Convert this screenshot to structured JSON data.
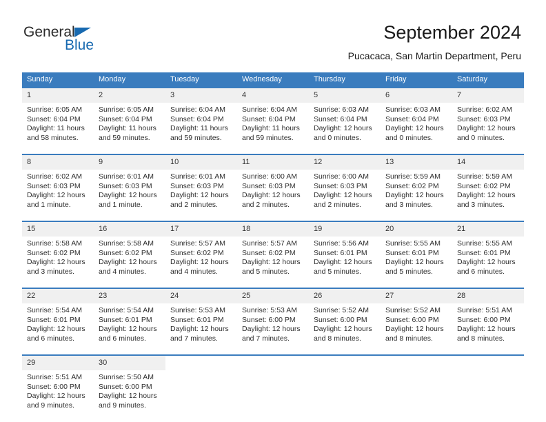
{
  "brand": {
    "name_part1": "General",
    "name_part2": "Blue"
  },
  "header": {
    "title": "September 2024",
    "subtitle": "Pucacaca, San Martin Department, Peru"
  },
  "colors": {
    "header_blue": "#3a7cbe",
    "brand_blue": "#1769b0",
    "daynum_background": "#f0f0f0",
    "text": "#1a1a1a"
  },
  "weekdays": [
    "Sunday",
    "Monday",
    "Tuesday",
    "Wednesday",
    "Thursday",
    "Friday",
    "Saturday"
  ],
  "labels": {
    "sunrise_prefix": "Sunrise:",
    "sunset_prefix": "Sunset:",
    "daylight_prefix": "Daylight:"
  },
  "weeks": [
    [
      {
        "day": "1",
        "sunrise": "Sunrise: 6:05 AM",
        "sunset": "Sunset: 6:04 PM",
        "daylight": "Daylight: 11 hours and 58 minutes."
      },
      {
        "day": "2",
        "sunrise": "Sunrise: 6:05 AM",
        "sunset": "Sunset: 6:04 PM",
        "daylight": "Daylight: 11 hours and 59 minutes."
      },
      {
        "day": "3",
        "sunrise": "Sunrise: 6:04 AM",
        "sunset": "Sunset: 6:04 PM",
        "daylight": "Daylight: 11 hours and 59 minutes."
      },
      {
        "day": "4",
        "sunrise": "Sunrise: 6:04 AM",
        "sunset": "Sunset: 6:04 PM",
        "daylight": "Daylight: 11 hours and 59 minutes."
      },
      {
        "day": "5",
        "sunrise": "Sunrise: 6:03 AM",
        "sunset": "Sunset: 6:04 PM",
        "daylight": "Daylight: 12 hours and 0 minutes."
      },
      {
        "day": "6",
        "sunrise": "Sunrise: 6:03 AM",
        "sunset": "Sunset: 6:04 PM",
        "daylight": "Daylight: 12 hours and 0 minutes."
      },
      {
        "day": "7",
        "sunrise": "Sunrise: 6:02 AM",
        "sunset": "Sunset: 6:03 PM",
        "daylight": "Daylight: 12 hours and 0 minutes."
      }
    ],
    [
      {
        "day": "8",
        "sunrise": "Sunrise: 6:02 AM",
        "sunset": "Sunset: 6:03 PM",
        "daylight": "Daylight: 12 hours and 1 minute."
      },
      {
        "day": "9",
        "sunrise": "Sunrise: 6:01 AM",
        "sunset": "Sunset: 6:03 PM",
        "daylight": "Daylight: 12 hours and 1 minute."
      },
      {
        "day": "10",
        "sunrise": "Sunrise: 6:01 AM",
        "sunset": "Sunset: 6:03 PM",
        "daylight": "Daylight: 12 hours and 2 minutes."
      },
      {
        "day": "11",
        "sunrise": "Sunrise: 6:00 AM",
        "sunset": "Sunset: 6:03 PM",
        "daylight": "Daylight: 12 hours and 2 minutes."
      },
      {
        "day": "12",
        "sunrise": "Sunrise: 6:00 AM",
        "sunset": "Sunset: 6:03 PM",
        "daylight": "Daylight: 12 hours and 2 minutes."
      },
      {
        "day": "13",
        "sunrise": "Sunrise: 5:59 AM",
        "sunset": "Sunset: 6:02 PM",
        "daylight": "Daylight: 12 hours and 3 minutes."
      },
      {
        "day": "14",
        "sunrise": "Sunrise: 5:59 AM",
        "sunset": "Sunset: 6:02 PM",
        "daylight": "Daylight: 12 hours and 3 minutes."
      }
    ],
    [
      {
        "day": "15",
        "sunrise": "Sunrise: 5:58 AM",
        "sunset": "Sunset: 6:02 PM",
        "daylight": "Daylight: 12 hours and 3 minutes."
      },
      {
        "day": "16",
        "sunrise": "Sunrise: 5:58 AM",
        "sunset": "Sunset: 6:02 PM",
        "daylight": "Daylight: 12 hours and 4 minutes."
      },
      {
        "day": "17",
        "sunrise": "Sunrise: 5:57 AM",
        "sunset": "Sunset: 6:02 PM",
        "daylight": "Daylight: 12 hours and 4 minutes."
      },
      {
        "day": "18",
        "sunrise": "Sunrise: 5:57 AM",
        "sunset": "Sunset: 6:02 PM",
        "daylight": "Daylight: 12 hours and 5 minutes."
      },
      {
        "day": "19",
        "sunrise": "Sunrise: 5:56 AM",
        "sunset": "Sunset: 6:01 PM",
        "daylight": "Daylight: 12 hours and 5 minutes."
      },
      {
        "day": "20",
        "sunrise": "Sunrise: 5:55 AM",
        "sunset": "Sunset: 6:01 PM",
        "daylight": "Daylight: 12 hours and 5 minutes."
      },
      {
        "day": "21",
        "sunrise": "Sunrise: 5:55 AM",
        "sunset": "Sunset: 6:01 PM",
        "daylight": "Daylight: 12 hours and 6 minutes."
      }
    ],
    [
      {
        "day": "22",
        "sunrise": "Sunrise: 5:54 AM",
        "sunset": "Sunset: 6:01 PM",
        "daylight": "Daylight: 12 hours and 6 minutes."
      },
      {
        "day": "23",
        "sunrise": "Sunrise: 5:54 AM",
        "sunset": "Sunset: 6:01 PM",
        "daylight": "Daylight: 12 hours and 6 minutes."
      },
      {
        "day": "24",
        "sunrise": "Sunrise: 5:53 AM",
        "sunset": "Sunset: 6:01 PM",
        "daylight": "Daylight: 12 hours and 7 minutes."
      },
      {
        "day": "25",
        "sunrise": "Sunrise: 5:53 AM",
        "sunset": "Sunset: 6:00 PM",
        "daylight": "Daylight: 12 hours and 7 minutes."
      },
      {
        "day": "26",
        "sunrise": "Sunrise: 5:52 AM",
        "sunset": "Sunset: 6:00 PM",
        "daylight": "Daylight: 12 hours and 8 minutes."
      },
      {
        "day": "27",
        "sunrise": "Sunrise: 5:52 AM",
        "sunset": "Sunset: 6:00 PM",
        "daylight": "Daylight: 12 hours and 8 minutes."
      },
      {
        "day": "28",
        "sunrise": "Sunrise: 5:51 AM",
        "sunset": "Sunset: 6:00 PM",
        "daylight": "Daylight: 12 hours and 8 minutes."
      }
    ],
    [
      {
        "day": "29",
        "sunrise": "Sunrise: 5:51 AM",
        "sunset": "Sunset: 6:00 PM",
        "daylight": "Daylight: 12 hours and 9 minutes."
      },
      {
        "day": "30",
        "sunrise": "Sunrise: 5:50 AM",
        "sunset": "Sunset: 6:00 PM",
        "daylight": "Daylight: 12 hours and 9 minutes."
      },
      {
        "day": "",
        "sunrise": "",
        "sunset": "",
        "daylight": ""
      },
      {
        "day": "",
        "sunrise": "",
        "sunset": "",
        "daylight": ""
      },
      {
        "day": "",
        "sunrise": "",
        "sunset": "",
        "daylight": ""
      },
      {
        "day": "",
        "sunrise": "",
        "sunset": "",
        "daylight": ""
      },
      {
        "day": "",
        "sunrise": "",
        "sunset": "",
        "daylight": ""
      }
    ]
  ]
}
